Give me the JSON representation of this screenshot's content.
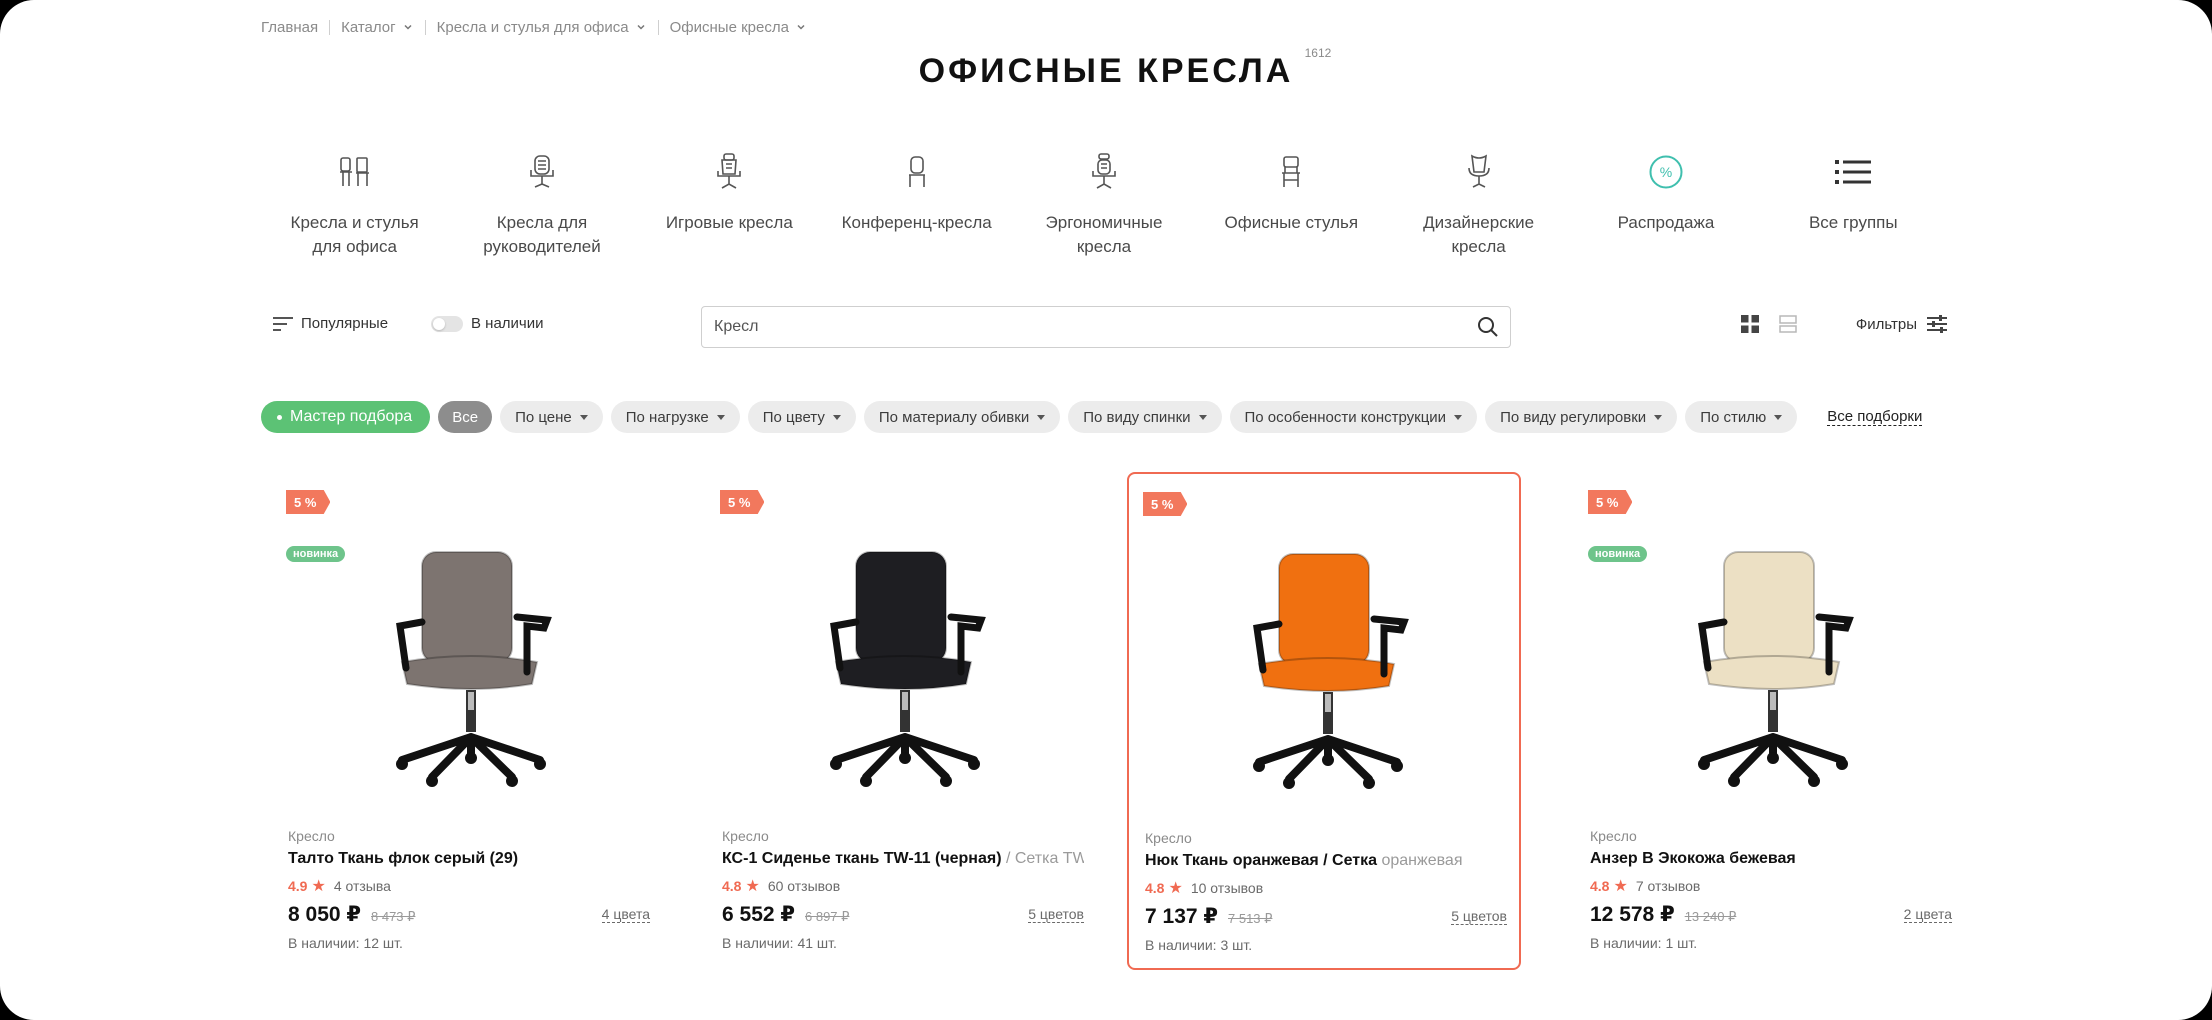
{
  "breadcrumbs": [
    {
      "label": "Главная",
      "dropdown": false
    },
    {
      "label": "Каталог",
      "dropdown": true
    },
    {
      "label": "Кресла и стулья для офиса",
      "dropdown": true
    },
    {
      "label": "Офисные кресла",
      "dropdown": true
    }
  ],
  "page": {
    "title": "ОФИСНЫЕ КРЕСЛА",
    "count": "1612"
  },
  "categories": [
    {
      "label": "Кресла и стулья\nдля офиса",
      "icon": "office-chairs-icon"
    },
    {
      "label": "Кресла для\nруководителей",
      "icon": "executive-chair-icon"
    },
    {
      "label": "Игровые кресла",
      "icon": "gaming-chair-icon"
    },
    {
      "label": "Конференц-кресла",
      "icon": "conference-chair-icon"
    },
    {
      "label": "Эргономичные\nкресла",
      "icon": "ergonomic-chair-icon"
    },
    {
      "label": "Офисные стулья",
      "icon": "office-stool-icon"
    },
    {
      "label": "Дизайнерские\nкресла",
      "icon": "designer-chair-icon"
    },
    {
      "label": "Распродажа",
      "icon": "percent-icon"
    },
    {
      "label": "Все группы",
      "icon": "list-icon"
    }
  ],
  "toolbar": {
    "sort_label": "Популярные",
    "stock_label": "В наличии",
    "search_value": "Кресл",
    "filters_label": "Фильтры"
  },
  "chips": {
    "master": "Мастер подбора",
    "all": "Все",
    "items": [
      "По цене",
      "По нагрузке",
      "По цвету",
      "По материалу обивки",
      "По виду спинки",
      "По особенности конструкции",
      "По виду регулировки",
      "По стилю"
    ],
    "all_sets": "Все подборки"
  },
  "products": [
    {
      "discount": "5 %",
      "is_new": true,
      "new_label": "новинка",
      "type": "Кресло",
      "name": "Талто Ткань флок серый (29)",
      "name_fade": "",
      "rating": "4.9",
      "reviews": "4 отзыва",
      "price": "8 050 ₽",
      "old_price": "8 473 ₽",
      "colors": "4 цвета",
      "availability": "В наличии: 12 шт.",
      "color_main": "#7d7470",
      "active": false
    },
    {
      "discount": "5 %",
      "is_new": false,
      "new_label": "",
      "type": "Кресло",
      "name": "КС-1 Сиденье ткань TW-11 (черная)",
      "name_fade": " / Сетка TW",
      "rating": "4.8",
      "reviews": "60 отзывов",
      "price": "6 552 ₽",
      "old_price": "6 897 ₽",
      "colors": "5 цветов",
      "availability": "В наличии: 41 шт.",
      "color_main": "#1e1e22",
      "active": false
    },
    {
      "discount": "5 %",
      "is_new": false,
      "new_label": "",
      "type": "Кресло",
      "name": "Нюк Ткань оранжевая / Сетка",
      "name_fade": " оранжевая",
      "rating": "4.8",
      "reviews": "10 отзывов",
      "price": "7 137 ₽",
      "old_price": "7 513 ₽",
      "colors": "5 цветов",
      "availability": "В наличии: 3 шт.",
      "color_main": "#f07010",
      "active": true
    },
    {
      "discount": "5 %",
      "is_new": true,
      "new_label": "новинка",
      "type": "Кресло",
      "name": "Анзер В Экокожа бежевая",
      "name_fade": "",
      "rating": "4.8",
      "reviews": "7 отзывов",
      "price": "12 578 ₽",
      "old_price": "13 240 ₽",
      "colors": "2 цвета",
      "availability": "В наличии: 1 шт.",
      "color_main": "#ece0c4",
      "active": false
    }
  ]
}
